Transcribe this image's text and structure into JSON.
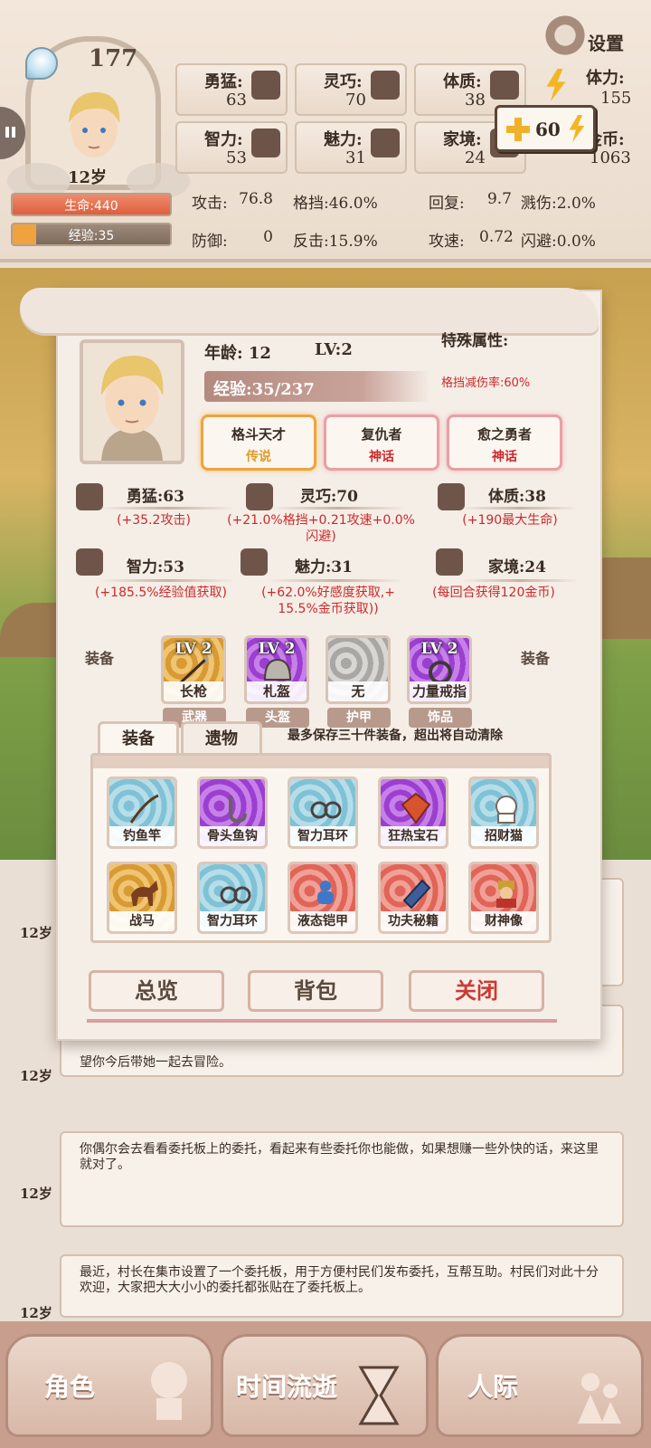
{
  "header": {
    "soul_points": "177",
    "age": "12岁",
    "hp_label": "生命:440",
    "exp_label": "经验:35",
    "exp_fraction": 0.15,
    "settings": "设置",
    "stats": [
      {
        "name": "勇猛:",
        "value": "63",
        "icon": "fist-icon"
      },
      {
        "name": "灵巧:",
        "value": "70",
        "icon": "scarf-icon"
      },
      {
        "name": "体质:",
        "value": "38",
        "icon": "arm-icon"
      },
      {
        "name": "智力:",
        "value": "53",
        "icon": "brain-icon"
      },
      {
        "name": "魅力:",
        "value": "31",
        "icon": "tulip-icon"
      },
      {
        "name": "家境:",
        "value": "24",
        "icon": "home-icon"
      }
    ],
    "stamina_label": "体力:",
    "stamina_value": "155",
    "gold_label": "金币:",
    "gold_value": "1063",
    "plus_value": "60",
    "combat": [
      {
        "k": "攻击:",
        "v": "76.8"
      },
      {
        "k": "格挡:",
        "v": "46.0%"
      },
      {
        "k": "回复:",
        "v": "9.7"
      },
      {
        "k": "溅伤:",
        "v": "2.0%"
      },
      {
        "k": "防御:",
        "v": "0"
      },
      {
        "k": "反击:",
        "v": "15.9%"
      },
      {
        "k": "攻速:",
        "v": "0.72"
      },
      {
        "k": "闪避:",
        "v": "0.0%"
      }
    ]
  },
  "panel": {
    "age": "年龄:  12",
    "level": "LV:2",
    "exp": "经验:35/237",
    "special_title": "特殊属性:",
    "special_text": "格挡减伤率:60%",
    "traits": [
      {
        "name": "格斗天才",
        "rarity": "传说"
      },
      {
        "name": "复仇者",
        "rarity": "神话"
      },
      {
        "name": "愈之勇者",
        "rarity": "神话"
      }
    ],
    "attrs": [
      {
        "name": "勇猛:63",
        "bonus": "(+35.2攻击)"
      },
      {
        "name": "灵巧:70",
        "bonus": "(+21.0%格挡+0.21攻速+0.0%\n闪避)"
      },
      {
        "name": "体质:38",
        "bonus": "(+190最大生命)"
      },
      {
        "name": "智力:53",
        "bonus": "(+185.5%经验值获取)"
      },
      {
        "name": "魅力:31",
        "bonus": "(+62.0%好感度获取,+\n15.5%金币获取))"
      },
      {
        "name": "家境:24",
        "bonus": "(每回合获得120金币)"
      }
    ],
    "equip_label": "装备",
    "equipped": [
      {
        "lv": "LV 2",
        "name": "长枪",
        "slot": "武器",
        "color": "orange"
      },
      {
        "lv": "LV 2",
        "name": "札盔",
        "slot": "头盔",
        "color": "purple"
      },
      {
        "lv": "",
        "name": "无",
        "slot": "护甲",
        "color": "gray"
      },
      {
        "lv": "LV 2",
        "name": "力量戒指",
        "slot": "饰品",
        "color": "purple"
      }
    ],
    "tabs": [
      "装备",
      "遗物"
    ],
    "tab_note": "最多保存三十件装备，超出将自动清除",
    "inventory": [
      {
        "name": "钓鱼竿",
        "color": "blue",
        "icon": "fishing-rod-icon"
      },
      {
        "name": "骨头鱼钩",
        "color": "purple",
        "icon": "hook-icon"
      },
      {
        "name": "智力耳环",
        "color": "blue",
        "icon": "earring-icon"
      },
      {
        "name": "狂热宝石",
        "color": "purple",
        "icon": "gem-icon"
      },
      {
        "name": "招财猫",
        "color": "blue",
        "icon": "lucky-cat-icon"
      },
      {
        "name": "战马",
        "color": "orange",
        "icon": "horse-icon"
      },
      {
        "name": "智力耳环",
        "color": "blue",
        "icon": "earring-icon"
      },
      {
        "name": "液态铠甲",
        "color": "red",
        "icon": "armor-icon"
      },
      {
        "name": "功夫秘籍",
        "color": "red",
        "icon": "book-icon"
      },
      {
        "name": "财神像",
        "color": "red",
        "icon": "statue-icon"
      }
    ],
    "buttons": {
      "overview": "总览",
      "backpack": "背包",
      "close": "关闭"
    }
  },
  "feed": [
    {
      "age": "12岁",
      "text": ""
    },
    {
      "age": "12岁",
      "text": "望你今后带她一起去冒险。"
    },
    {
      "age": "12岁",
      "text": "你偶尔会去看看委托板上的委托，看起来有些委托你也能做，如果想赚一些外快的话，来这里就对了。"
    },
    {
      "age": "12岁",
      "text": "最近，村长在集市设置了一个委托板，用于方便村民们发布委托，互帮互助。村民们对此十分欢迎，大家把大大小小的委托都张贴在了委托板上。"
    }
  ],
  "nav": [
    "角色",
    "时间流逝",
    "人际"
  ]
}
